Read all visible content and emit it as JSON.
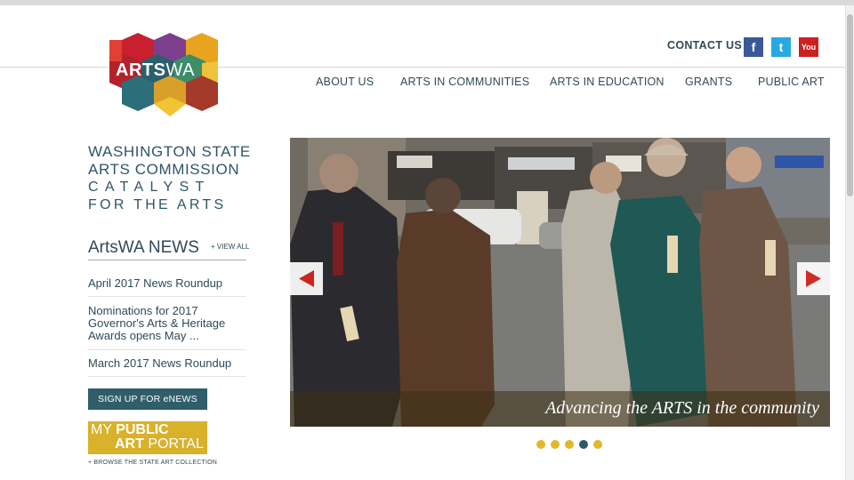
{
  "logo": {
    "text_bold": "ARTS",
    "text_light": "WA"
  },
  "header": {
    "contact_label": "CONTACT US",
    "social": [
      {
        "name": "facebook",
        "glyph": "f",
        "color": "#3b5998"
      },
      {
        "name": "twitter",
        "glyph": "t",
        "color": "#29a9e1"
      },
      {
        "name": "youtube",
        "glyph": "You",
        "color": "#cd201f"
      }
    ]
  },
  "nav": {
    "items": [
      {
        "label": "ABOUT US"
      },
      {
        "label": "ARTS IN COMMUNITIES"
      },
      {
        "label": "ARTS IN EDUCATION"
      },
      {
        "label": "GRANTS"
      },
      {
        "label": "PUBLIC ART"
      }
    ]
  },
  "sidebar": {
    "org_line1": "WASHINGTON STATE",
    "org_line2": "ARTS COMMISSION",
    "tagline_line1": "CATALYST",
    "tagline_line2": "FOR THE ARTS",
    "news_title": "ArtsWA NEWS",
    "view_all": "+ VIEW ALL",
    "news": [
      {
        "title": "April 2017 News Roundup"
      },
      {
        "title": "Nominations for 2017 Governor's Arts & Heritage Awards opens May ..."
      },
      {
        "title": "March 2017 News Roundup"
      }
    ],
    "signup_label": "SIGN UP FOR eNEWS",
    "portal": {
      "line1_light": "MY ",
      "line1_bold": "PUBLIC",
      "line2_bold": "ART",
      "line2_light": " PORTAL"
    },
    "browse_label": "+ BROWSE THE STATE ART COLLECTION"
  },
  "slideshow": {
    "caption": "Advancing the ARTS in the community",
    "active_index": 3,
    "slide_count": 5,
    "dot_color": "#e0b82a",
    "dot_active_color": "#2f5666"
  },
  "colors": {
    "accent": "#2f5666",
    "button_teal": "#2f5e6a",
    "portal_gold": "#d9b12a",
    "arrow_red": "#d9261c"
  }
}
